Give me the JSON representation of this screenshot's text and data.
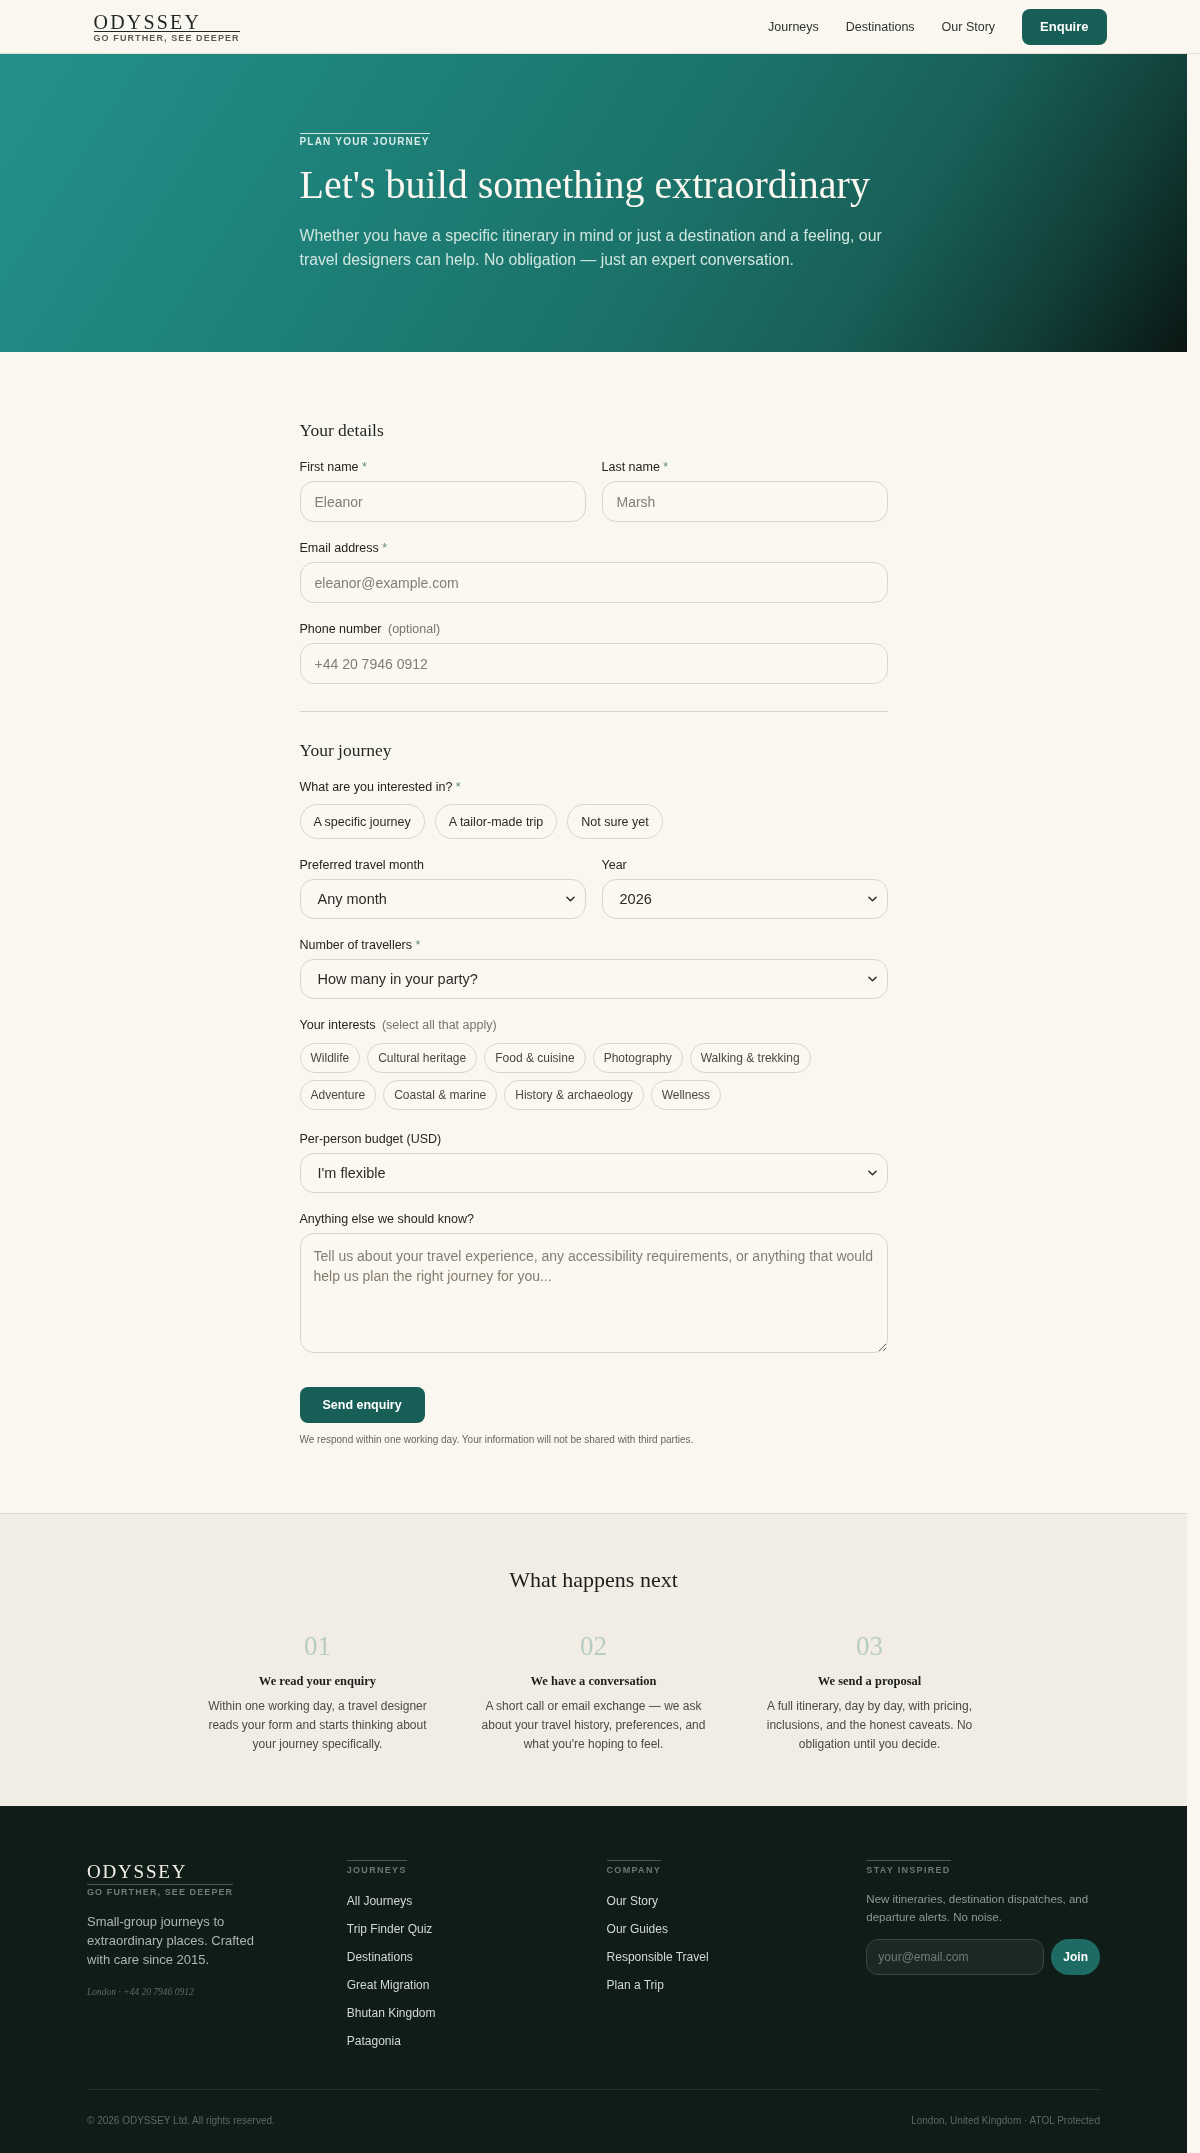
{
  "header": {
    "logo": {
      "name": "ODYSSEY",
      "tagline": "GO FURTHER, SEE DEEPER"
    },
    "nav": [
      {
        "label": "Journeys"
      },
      {
        "label": "Destinations"
      },
      {
        "label": "Our Story"
      }
    ],
    "cta": "Enquire"
  },
  "hero": {
    "eyebrow": "PLAN YOUR JOURNEY",
    "title": "Let's build something extraordinary",
    "text": "Whether you have a specific itinerary in mind or just a destination and a feeling, our travel designers can help. No obligation — just an expert conversation."
  },
  "form": {
    "sections": [
      {
        "title": "Your details",
        "rows": [
          [
            {
              "kind": "text",
              "label": "First name",
              "mark": "*",
              "placeholder": "Eleanor"
            },
            {
              "kind": "text",
              "label": "Last name",
              "mark": "*",
              "placeholder": "Marsh"
            }
          ],
          [
            {
              "kind": "text",
              "label": "Email address",
              "mark": "*",
              "placeholder": "eleanor@example.com"
            }
          ],
          [
            {
              "kind": "text",
              "label": "Phone number",
              "note": "(optional)",
              "placeholder": "+44 20 7946 0912"
            }
          ]
        ]
      },
      {
        "title": "Your journey",
        "rows": [
          [
            {
              "kind": "choice",
              "label": "What are you interested in?",
              "mark": "*",
              "options": [
                {
                  "label": "A specific journey",
                  "selected": false
                },
                {
                  "label": "A tailor-made trip",
                  "selected": false
                },
                {
                  "label": "Not sure yet",
                  "selected": false
                }
              ]
            }
          ],
          [
            {
              "kind": "select",
              "label": "Preferred travel month",
              "value": "Any month"
            },
            {
              "kind": "select",
              "label": "Year",
              "value": "2026"
            }
          ],
          [
            {
              "kind": "select",
              "label": "Number of travellers",
              "mark": "*",
              "value": "How many in your party?"
            }
          ],
          [
            {
              "kind": "tags",
              "label": "Your interests",
              "note": "(select all that apply)",
              "options": [
                {
                  "label": "Wildlife",
                  "selected": false
                },
                {
                  "label": "Cultural heritage",
                  "selected": false
                },
                {
                  "label": "Food & cuisine",
                  "selected": false
                },
                {
                  "label": "Photography",
                  "selected": false
                },
                {
                  "label": "Walking & trekking",
                  "selected": false
                },
                {
                  "label": "Adventure",
                  "selected": false
                },
                {
                  "label": "Coastal & marine",
                  "selected": false
                },
                {
                  "label": "History & archaeology",
                  "selected": false
                },
                {
                  "label": "Wellness",
                  "selected": false
                }
              ]
            }
          ],
          [
            {
              "kind": "select",
              "label": "Per-person budget (USD)",
              "value": "I'm flexible"
            }
          ],
          [
            {
              "kind": "textarea",
              "label": "Anything else we should know?",
              "placeholder": "Tell us about your travel experience, any accessibility requirements, or anything that would help us plan the right journey for you..."
            }
          ]
        ]
      }
    ],
    "submit": "Send enquiry",
    "note": "We respond within one working day. Your information will not be shared with third parties."
  },
  "next_steps": {
    "title": "What happens next",
    "items": [
      {
        "number": "01",
        "title": "We read your enquiry",
        "text": "Within one working day, a travel designer reads your form and starts thinking about your journey specifically."
      },
      {
        "number": "02",
        "title": "We have a conversation",
        "text": "A short call or email exchange — we ask about your travel history, preferences, and what you're hoping to feel."
      },
      {
        "number": "03",
        "title": "We send a proposal",
        "text": "A full itinerary, day by day, with pricing, inclusions, and the honest caveats. No obligation until you decide."
      }
    ]
  },
  "footer": {
    "brand": {
      "name": "ODYSSEY",
      "tagline": "GO FURTHER, SEE DEEPER",
      "text": "Small-group journeys to extraordinary places. Crafted with care since 2015.",
      "contact": "London · +44 20 7946 0912"
    },
    "columns": [
      {
        "heading": "JOURNEYS",
        "links": [
          "All Journeys",
          "Trip Finder Quiz",
          "Destinations",
          "Great Migration",
          "Bhutan Kingdom",
          "Patagonia"
        ]
      },
      {
        "heading": "COMPANY",
        "links": [
          "Our Story",
          "Our Guides",
          "Responsible Travel",
          "Plan a Trip"
        ]
      }
    ],
    "newsletter": {
      "heading": "STAY INSPIRED",
      "text": "New itineraries, destination dispatches, and departure alerts. No noise.",
      "placeholder": "your@email.com",
      "button": "Join"
    },
    "copyright": "© 2026 ODYSSEY Ltd. All rights reserved.",
    "info": "London, United Kingdom · ATOL Protected"
  }
}
